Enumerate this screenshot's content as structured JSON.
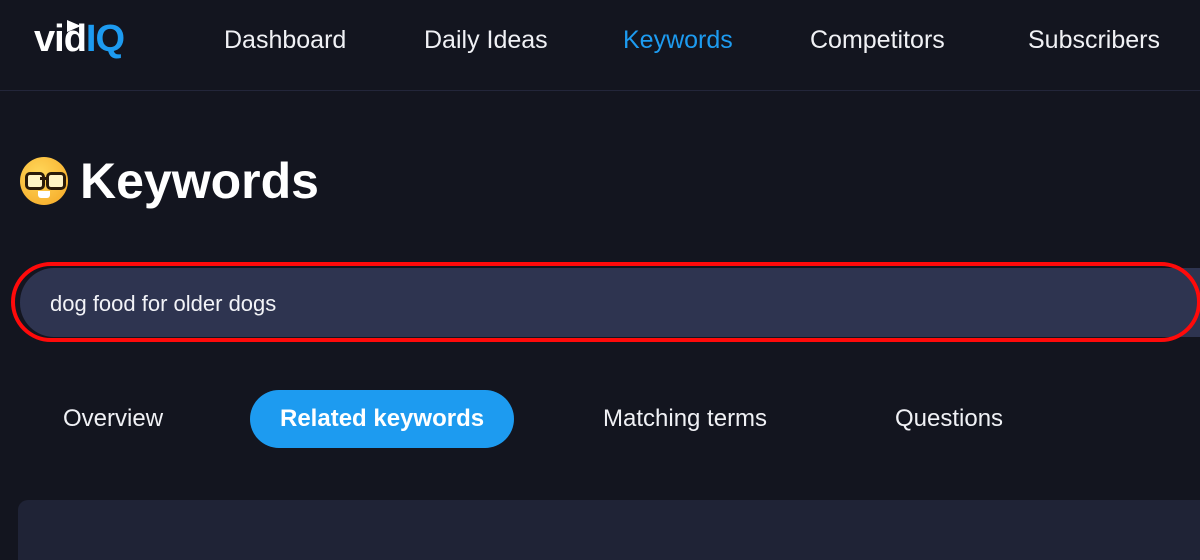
{
  "brand": {
    "logo_text_a": "vid",
    "logo_text_b": "IQ",
    "accent": "#1d9bf0"
  },
  "nav": {
    "items": [
      {
        "label": "Dashboard"
      },
      {
        "label": "Daily Ideas"
      },
      {
        "label": "Keywords",
        "active": true
      },
      {
        "label": "Competitors"
      },
      {
        "label": "Subscribers"
      }
    ]
  },
  "page": {
    "title": "Keywords",
    "title_icon": "nerd-face-emoji"
  },
  "search": {
    "value": "dog food for older dogs",
    "highlight_color": "#ff0a0a"
  },
  "tabs": [
    {
      "label": "Overview"
    },
    {
      "label": "Related keywords",
      "active": true
    },
    {
      "label": "Matching terms"
    },
    {
      "label": "Questions"
    }
  ]
}
